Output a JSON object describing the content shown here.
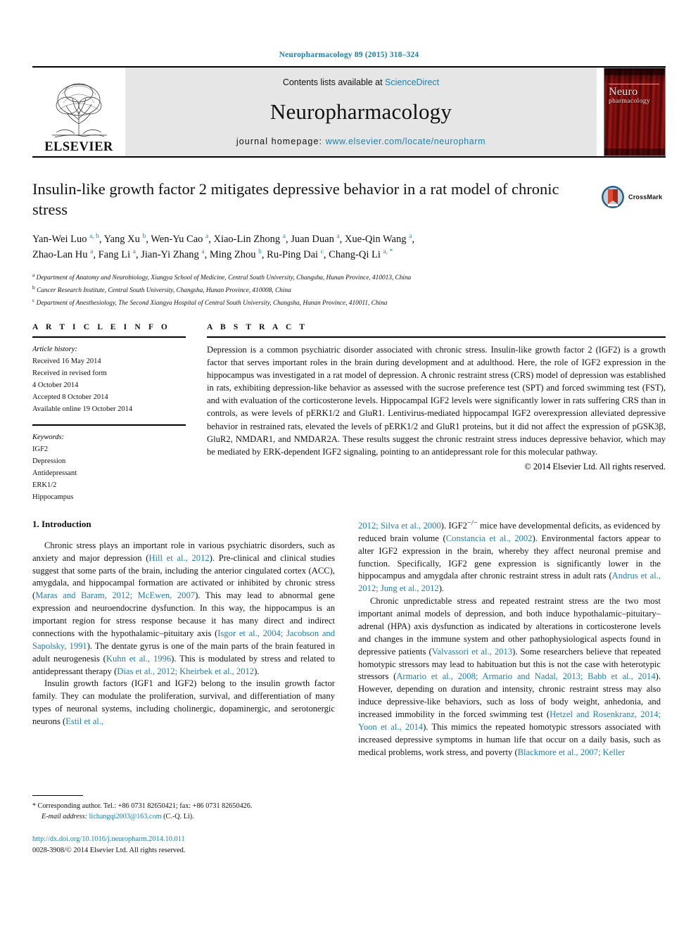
{
  "running_head": "Neuropharmacology 89 (2015) 318–324",
  "header": {
    "contents_line_prefix": "Contents lists available at ",
    "contents_link": "ScienceDirect",
    "journal_title": "Neuropharmacology",
    "homepage_prefix": "journal homepage: ",
    "homepage_link": "www.elsevier.com/locate/neuropharm",
    "publisher": "ELSEVIER",
    "cover_title_line1": "Neuro",
    "cover_title_line2": "pharmacology",
    "link_color": "#1f7fa8",
    "band_color": "#e6e6e6",
    "elsevier_accent": "#E87722"
  },
  "article": {
    "title": "Insulin-like growth factor 2 mitigates depressive behavior in a rat model of chronic stress",
    "crossmark_label": "CrossMark",
    "authors_line1": "Yan-Wei Luo <sup>a, b</sup>, Yang Xu <sup>b</sup>, Wen-Yu Cao <sup>a</sup>, Xiao-Lin Zhong <sup>a</sup>, Juan Duan <sup>a</sup>, Xue-Qin Wang <sup>a</sup>,",
    "authors_line2": "Zhao-Lan Hu <sup>a</sup>, Fang Li <sup>a</sup>, Jian-Yi Zhang <sup>a</sup>, Ming Zhou <sup>b</sup>, Ru-Ping Dai <sup>c</sup>, Chang-Qi Li <sup>a, *</sup>",
    "affiliations": [
      "<sup>a</sup> Department of Anatomy and Neurobiology, Xiangya School of Medicine, Central South University, Changsha, Hunan Province, 410013, China",
      "<sup>b</sup> Cancer Research Institute, Central South University, Changsha, Hunan Province, 410008, China",
      "<sup>c</sup> Department of Anesthesiology, The Second Xiangya Hospital of Central South University, Changsha, Hunan Province, 410011, China"
    ]
  },
  "article_info": {
    "heading": "A R T I C L E   I N F O",
    "history_label": "Article history:",
    "history": [
      "Received 16 May 2014",
      "Received in revised form",
      "4 October 2014",
      "Accepted 8 October 2014",
      "Available online 19 October 2014"
    ],
    "keywords_label": "Keywords:",
    "keywords": [
      "IGF2",
      "Depression",
      "Antidepressant",
      "ERK1/2",
      "Hippocampus"
    ]
  },
  "abstract": {
    "heading": "A B S T R A C T",
    "text": "Depression is a common psychiatric disorder associated with chronic stress. Insulin-like growth factor 2 (IGF2) is a growth factor that serves important roles in the brain during development and at adulthood. Here, the role of IGF2 expression in the hippocampus was investigated in a rat model of depression. A chronic restraint stress (CRS) model of depression was established in rats, exhibiting depression-like behavior as assessed with the sucrose preference test (SPT) and forced swimming test (FST), and with evaluation of the corticosterone levels. Hippocampal IGF2 levels were significantly lower in rats suffering CRS than in controls, as were levels of pERK1/2 and GluR1. Lentivirus-mediated hippocampal IGF2 overexpression alleviated depressive behavior in restrained rats, elevated the levels of pERK1/2 and GluR1 proteins, but it did not affect the expression of pGSK3β, GluR2, NMDAR1, and NMDAR2A. These results suggest the chronic restraint stress induces depressive behavior, which may be mediated by ERK-dependent IGF2 signaling, pointing to an antidepressant role for this molecular pathway.",
    "copyright": "© 2014 Elsevier Ltd. All rights reserved."
  },
  "body": {
    "section_heading": "1. Introduction",
    "left_paragraphs": [
      "Chronic stress plays an important role in various psychiatric disorders, such as anxiety and major depression (<span class=\"ref\">Hill et al., 2012</span>). Pre-clinical and clinical studies suggest that some parts of the brain, including the anterior cingulated cortex (ACC), amygdala, and hippocampal formation are activated or inhibited by chronic stress (<span class=\"ref\">Maras and Baram, 2012; McEwen, 2007</span>). This may lead to abnormal gene expression and neuroendocrine dysfunction. In this way, the hippocampus is an important region for stress response because it has many direct and indirect connections with the hypothalamic–pituitary axis (<span class=\"ref\">Isgor et al., 2004; Jacobson and Sapolsky, 1991</span>). The dentate gyrus is one of the main parts of the brain featured in adult neurogenesis (<span class=\"ref\">Kuhn et al., 1996</span>). This is modulated by stress and related to antidepressant therapy (<span class=\"ref\">Dias et al., 2012; Kheirbek et al., 2012</span>).",
      "Insulin growth factors (IGF1 and IGF2) belong to the insulin growth factor family. They can modulate the proliferation, survival, and differentiation of many types of neuronal systems, including cholinergic, dopaminergic, and serotonergic neurons (<span class=\"ref\">Estil et al.,</span>"
    ],
    "right_paragraphs": [
      "<span class=\"ref\">2012; Silva et al., 2000</span>). IGF2<sup>−/−</sup> mice have developmental deficits, as evidenced by reduced brain volume (<span class=\"ref\">Constancia et al., 2002</span>). Environmental factors appear to alter IGF2 expression in the brain, whereby they affect neuronal premise and function. Specifically, IGF2 gene expression is significantly lower in the hippocampus and amygdala after chronic restraint stress in adult rats (<span class=\"ref\">Andrus et al., 2012; Jung et al., 2012</span>).",
      "Chronic unpredictable stress and repeated restraint stress are the two most important animal models of depression, and both induce hypothalamic–pituitary–adrenal (HPA) axis dysfunction as indicated by alterations in corticosterone levels and changes in the immune system and other pathophysiological aspects found in depressive patients (<span class=\"ref\">Valvassori et al., 2013</span>). Some researchers believe that repeated homotypic stressors may lead to habituation but this is not the case with heterotypic stressors (<span class=\"ref\">Armario et al., 2008; Armario and Nadal, 2013; Babb et al., 2014</span>). However, depending on duration and intensity, chronic restraint stress may also induce depressive-like behaviors, such as loss of body weight, anhedonia, and increased immobility in the forced swimming test (<span class=\"ref\">Hetzel and Rosenkranz, 2014; Yoon et al., 2014</span>). This mimics the repeated homotypic stressors associated with increased depressive symptoms in human life that occur on a daily basis, such as medical problems, work stress, and poverty (<span class=\"ref\">Blackmore et al., 2007; Keller</span>"
    ]
  },
  "footer": {
    "corresponding": "<span class=\"star\">*</span> Corresponding author. Tel.: +86 0731 82650421; fax: +86 0731 82650426.",
    "email_label": "E-mail address:",
    "email": "lichangqi2003@163.com",
    "email_suffix": "(C.-Q. Li).",
    "doi": "http://dx.doi.org/10.1016/j.neuropharm.2014.10.011",
    "issn": "0028-3908/© 2014 Elsevier Ltd. All rights reserved."
  }
}
